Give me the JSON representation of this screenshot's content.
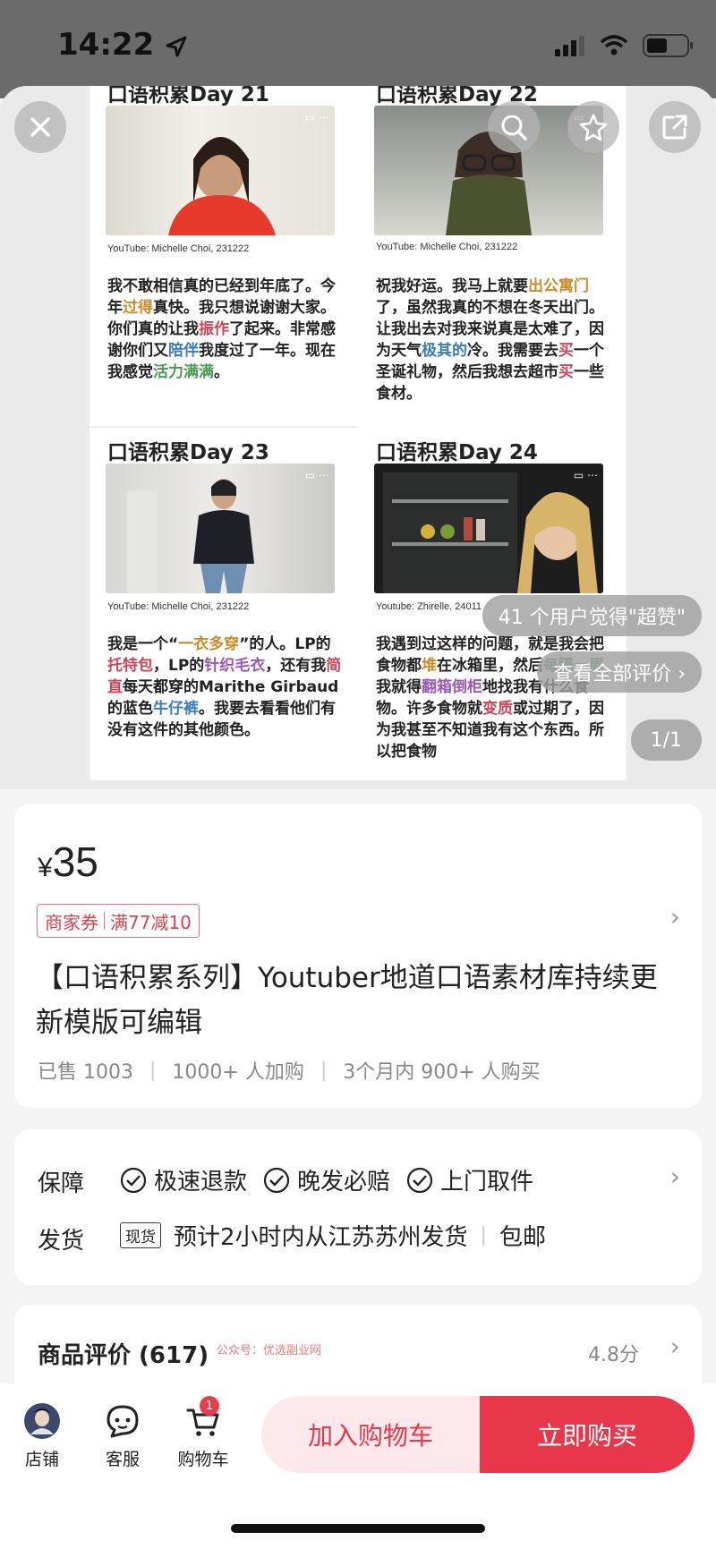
{
  "status_bar": {
    "time": "14:22"
  },
  "gallery": {
    "tiles": [
      {
        "title": "口语积累Day 21",
        "credit": "YouTube: Michelle Choi, 231222",
        "text": [
          {
            "t": "我不敢相信真的已经到年底了。今年"
          },
          {
            "t": "过得",
            "c": "hl-orange"
          },
          {
            "t": "真快。我只想说谢谢大家。你们真的让我"
          },
          {
            "t": "振作",
            "c": "hl-red"
          },
          {
            "t": "了起来。非常感谢你们又"
          },
          {
            "t": "陪伴",
            "c": "hl-blue"
          },
          {
            "t": "我度过了一年。现在我感觉"
          },
          {
            "t": "活力满满",
            "c": "hl-green"
          },
          {
            "t": "。"
          }
        ]
      },
      {
        "title": "口语积累Day 22",
        "credit": "YouTube: Michelle Choi, 231222",
        "text": [
          {
            "t": "祝我好运。我马上就要"
          },
          {
            "t": "出公寓门",
            "c": "hl-orange"
          },
          {
            "t": "了，虽然我真的不想在冬天出门。让我出去对我来说真是太难了，因为天气"
          },
          {
            "t": "极其的",
            "c": "hl-blue"
          },
          {
            "t": "冷。我需要去"
          },
          {
            "t": "买",
            "c": "hl-red"
          },
          {
            "t": "一个圣诞礼物，然后我想去超市"
          },
          {
            "t": "买",
            "c": "hl-red"
          },
          {
            "t": "一些食材。"
          }
        ]
      },
      {
        "title": "口语积累Day 23",
        "credit": "YouTube: Michelle Choi, 231222",
        "text": [
          {
            "t": "我是一个“"
          },
          {
            "t": "一衣多穿",
            "c": "hl-orange"
          },
          {
            "t": "”的人。LP的"
          },
          {
            "t": "托特包",
            "c": "hl-red"
          },
          {
            "t": "，LP的"
          },
          {
            "t": "针织毛衣",
            "c": "hl-purple"
          },
          {
            "t": "，还有我"
          },
          {
            "t": "简直",
            "c": "hl-red"
          },
          {
            "t": "每天都穿的Marithe Girbaud的蓝色"
          },
          {
            "t": "牛仔裤",
            "c": "hl-blue"
          },
          {
            "t": "。我要去看看他们有没有这件的其他颜色。"
          }
        ]
      },
      {
        "title": "口语积累Day 24",
        "credit": "Youtube: Zhirelle, 24011",
        "text": [
          {
            "t": "我遇到过这样的问题，就是我会把食物都"
          },
          {
            "t": "堆",
            "c": "hl-orange"
          },
          {
            "t": "在冰箱里，然后"
          },
          {
            "t": "每隔一周",
            "c": "hl-green"
          },
          {
            "t": "我就得"
          },
          {
            "t": "翻箱倒柜",
            "c": "hl-purple"
          },
          {
            "t": "地找我有什么食物。许多食物就"
          },
          {
            "t": "变质",
            "c": "hl-red"
          },
          {
            "t": "或过期了，因为我甚至不知道我有这个东西。所以把食物"
          }
        ]
      }
    ],
    "pills": {
      "likes": "41 个用户觉得\"超赞\"",
      "all_reviews": "查看全部评价 ›",
      "page": "1/1"
    }
  },
  "product": {
    "currency": "¥",
    "price": "35",
    "coupon_label": "商家券",
    "coupon_value": "满77减10",
    "title": "【口语积累系列】Youtuber地道口语素材库持续更新模版可编辑",
    "stats": [
      "已售 1003",
      "1000+ 人加购",
      "3个月内 900+ 人购买"
    ]
  },
  "service": {
    "guarantee_label": "保障",
    "guarantees": [
      "极速退款",
      "晚发必赔",
      "上门取件"
    ],
    "shipping_label": "发货",
    "stock_tag": "现货",
    "shipping_text": "预计2小时内从江苏苏州发货",
    "free_shipping": "包邮"
  },
  "reviews": {
    "label": "商品评价 (617)",
    "watermark": "公众号：优选副业网",
    "score": "4.8分"
  },
  "bottom_bar": {
    "store": "店铺",
    "service": "客服",
    "cart": "购物车",
    "cart_count": "1",
    "add_to_cart": "加入购物车",
    "buy_now": "立即购买"
  },
  "colors": {
    "accent": "#e8374b",
    "accent_light": "#fde9ec"
  }
}
